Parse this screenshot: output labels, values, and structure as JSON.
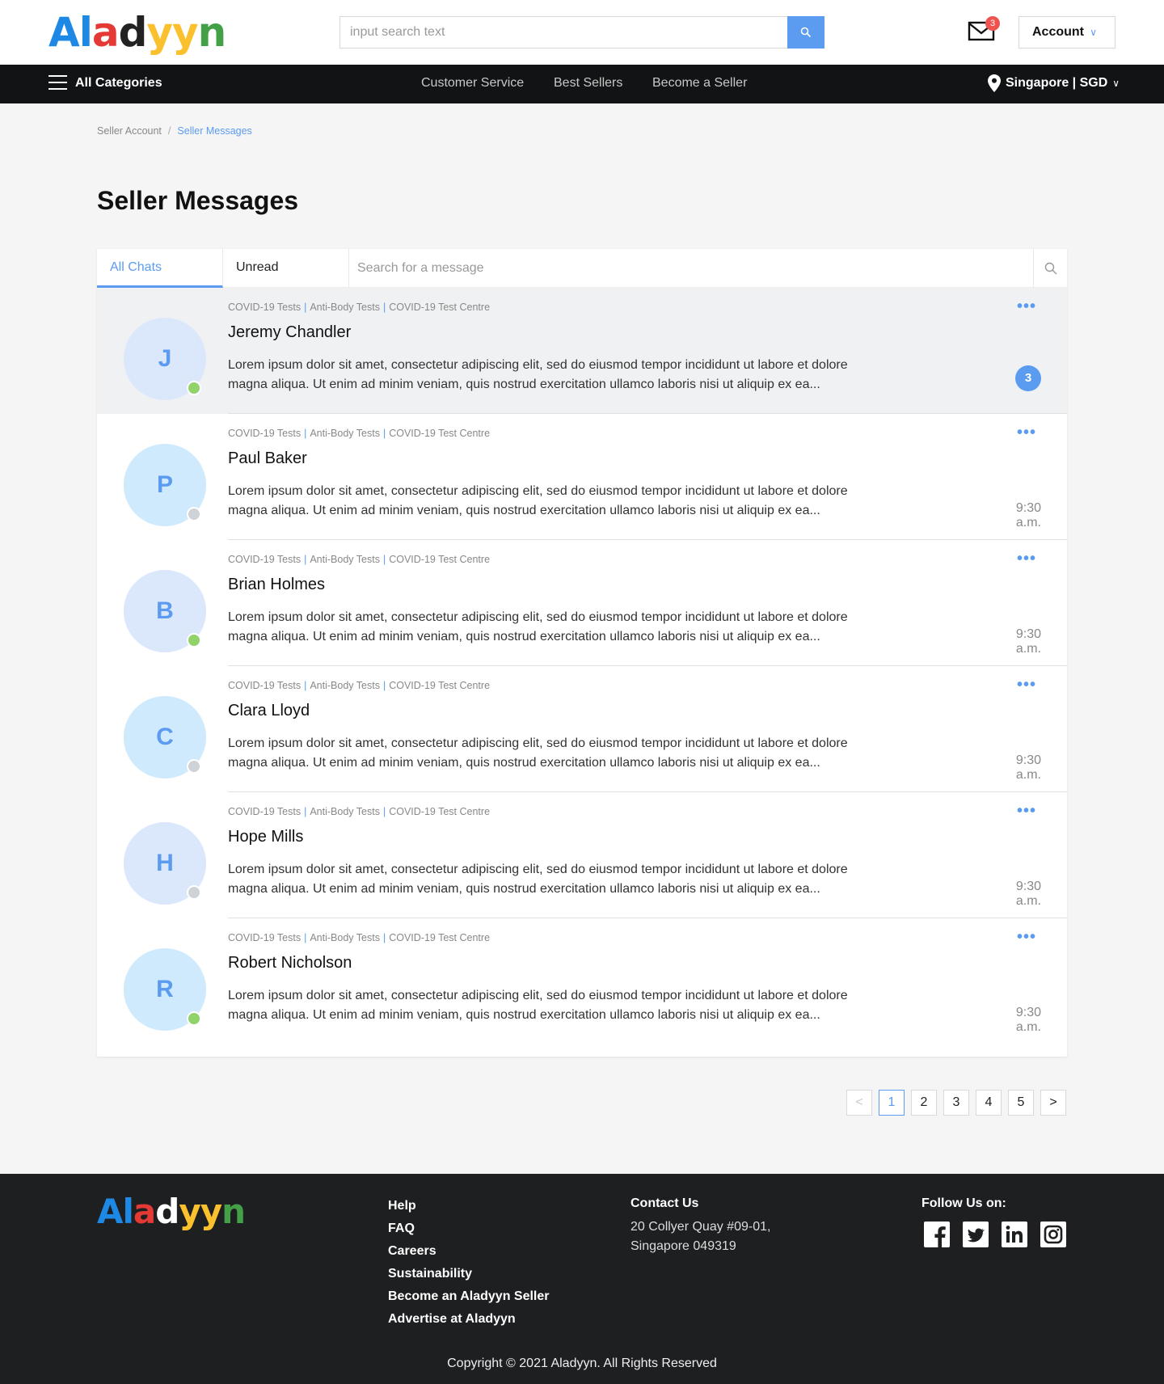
{
  "brand": {
    "name": "Aladyyn",
    "letters": [
      {
        "ch": "A",
        "color": "#1e88e5"
      },
      {
        "ch": "l",
        "color": "#1e88e5"
      },
      {
        "ch": "a",
        "color": "#e53935"
      },
      {
        "ch": "d",
        "color": "#222222"
      },
      {
        "ch": "y",
        "color": "#fbc02d"
      },
      {
        "ch": "y",
        "color": "#fbc02d"
      },
      {
        "ch": "n",
        "color": "#43a047"
      }
    ],
    "footer_letters": [
      {
        "ch": "A",
        "color": "#1e88e5"
      },
      {
        "ch": "l",
        "color": "#1e88e5"
      },
      {
        "ch": "a",
        "color": "#e53935"
      },
      {
        "ch": "d",
        "color": "#ffffff"
      },
      {
        "ch": "y",
        "color": "#fbc02d"
      },
      {
        "ch": "y",
        "color": "#fbc02d"
      },
      {
        "ch": "n",
        "color": "#43a047"
      }
    ]
  },
  "header": {
    "search_placeholder": "input search text",
    "mail_count": "3",
    "account_label": "Account"
  },
  "nav": {
    "categories_label": "All Categories",
    "links": [
      "Customer Service",
      "Best Sellers",
      "Become a Seller"
    ],
    "region": "Singapore | SGD"
  },
  "breadcrumb": {
    "parent": "Seller Account",
    "separator": "/",
    "current": "Seller Messages"
  },
  "page_title": "Seller Messages",
  "tabs": {
    "all_chats": "All Chats",
    "unread": "Unread Messages",
    "search_placeholder": "Search for a message"
  },
  "tag_labels": [
    "COVID-19 Tests",
    "Anti-Body Tests",
    "COVID-19 Test Centre"
  ],
  "messages": [
    {
      "initial": "J",
      "name": "Jeremy Chandler",
      "online": true,
      "avatar_bg": "#dbe7fb",
      "unread": "3",
      "time": "",
      "preview": "Lorem ipsum dolor sit amet, consectetur adipiscing elit, sed do eiusmod tempor incididunt ut labore et dolore magna aliqua. Ut enim ad minim veniam, quis nostrud exercitation ullamco laboris nisi ut aliquip ex ea..."
    },
    {
      "initial": "P",
      "name": "Paul Baker",
      "online": false,
      "avatar_bg": "#cfe9fd",
      "unread": "",
      "time": "9:30 a.m.",
      "preview": "Lorem ipsum dolor sit amet, consectetur adipiscing elit, sed do eiusmod tempor incididunt ut labore et dolore magna aliqua. Ut enim ad minim veniam, quis nostrud exercitation ullamco laboris nisi ut aliquip ex ea..."
    },
    {
      "initial": "B",
      "name": "Brian Holmes",
      "online": true,
      "avatar_bg": "#dbe7fb",
      "unread": "",
      "time": "9:30 a.m.",
      "preview": "Lorem ipsum dolor sit amet, consectetur adipiscing elit, sed do eiusmod tempor incididunt ut labore et dolore magna aliqua. Ut enim ad minim veniam, quis nostrud exercitation ullamco laboris nisi ut aliquip ex ea..."
    },
    {
      "initial": "C",
      "name": "Clara Lloyd",
      "online": false,
      "avatar_bg": "#cfe9fd",
      "unread": "",
      "time": "9:30 a.m.",
      "preview": "Lorem ipsum dolor sit amet, consectetur adipiscing elit, sed do eiusmod tempor incididunt ut labore et dolore magna aliqua. Ut enim ad minim veniam, quis nostrud exercitation ullamco laboris nisi ut aliquip ex ea..."
    },
    {
      "initial": "H",
      "name": "Hope Mills",
      "online": false,
      "avatar_bg": "#dbe7fb",
      "unread": "",
      "time": "9:30 a.m.",
      "preview": "Lorem ipsum dolor sit amet, consectetur adipiscing elit, sed do eiusmod tempor incididunt ut labore et dolore magna aliqua. Ut enim ad minim veniam, quis nostrud exercitation ullamco laboris nisi ut aliquip ex ea..."
    },
    {
      "initial": "R",
      "name": "Robert Nicholson",
      "online": true,
      "avatar_bg": "#cfe9fd",
      "unread": "",
      "time": "9:30 a.m.",
      "preview": "Lorem ipsum dolor sit amet, consectetur adipiscing elit, sed do eiusmod tempor incididunt ut labore et dolore magna aliqua. Ut enim ad minim veniam, quis nostrud exercitation ullamco laboris nisi ut aliquip ex ea..."
    }
  ],
  "status_colors": {
    "online": "#8fd36a",
    "offline": "#cfd3d8"
  },
  "pagination": {
    "prev": "<",
    "pages": [
      "1",
      "2",
      "3",
      "4",
      "5"
    ],
    "current": "1",
    "next": ">"
  },
  "footer": {
    "links": [
      "Help",
      "FAQ",
      "Careers",
      "Sustainability",
      "Become an Aladyyn Seller",
      "Advertise at Aladyyn"
    ],
    "contact_heading": "Contact Us",
    "address_line1": "20 Collyer Quay #09-01,",
    "address_line2": "Singapore 049319",
    "follow_heading": "Follow Us on:",
    "social": [
      "facebook-icon",
      "twitter-icon",
      "linkedin-icon",
      "instagram-icon"
    ],
    "copyright": "Copyright © 2021 Aladyyn. All Rights Reserved"
  }
}
